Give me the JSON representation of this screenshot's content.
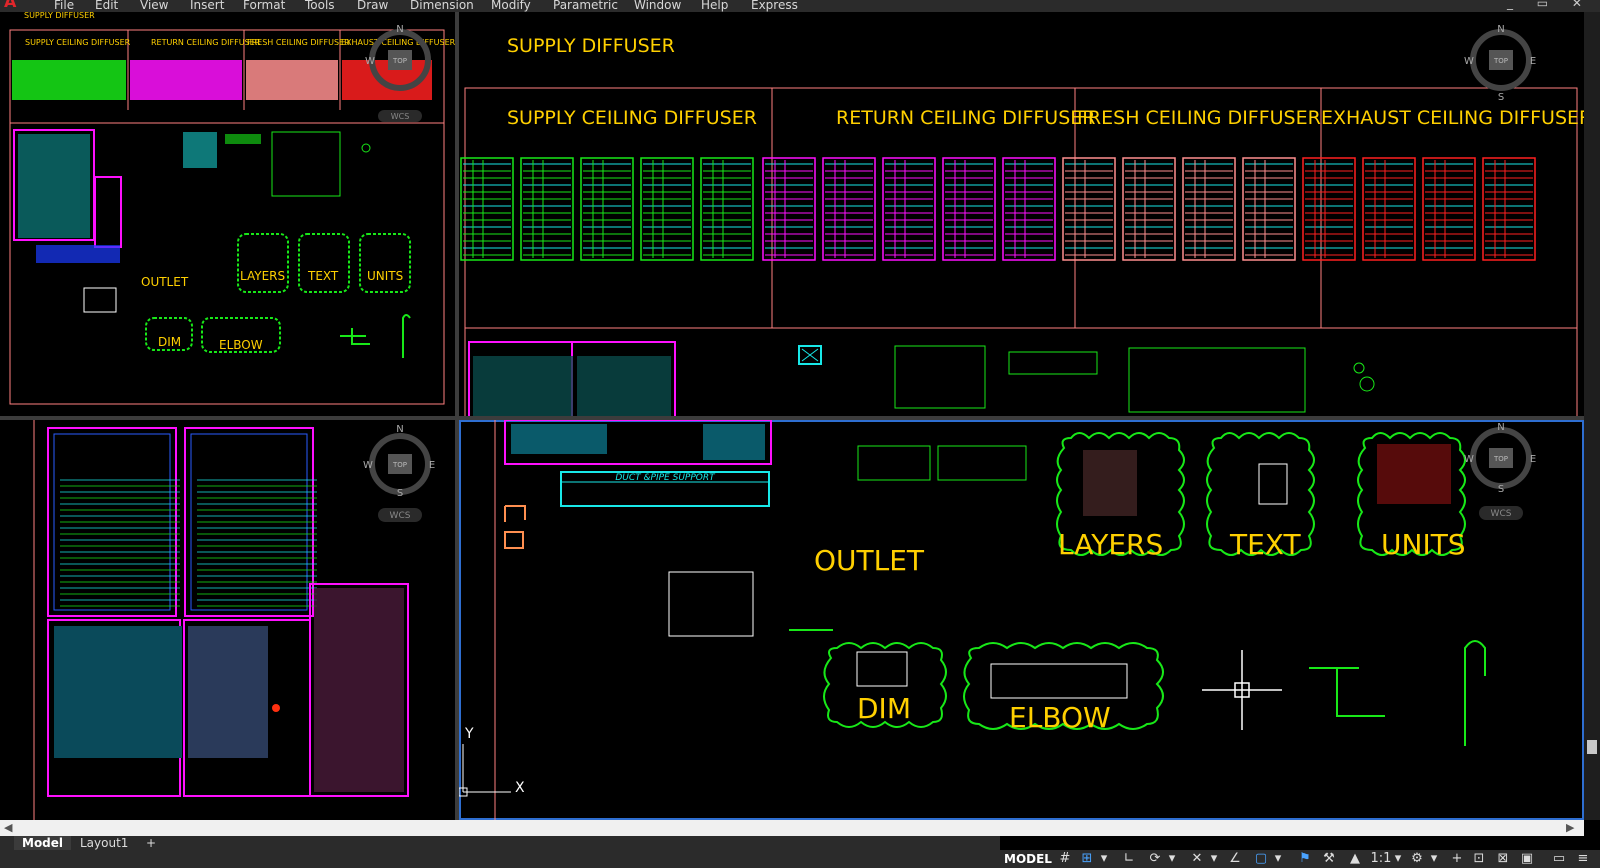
{
  "app": {
    "logo": "A"
  },
  "menu": [
    "File",
    "Edit",
    "View",
    "Insert",
    "Format",
    "Tools",
    "Draw",
    "Dimension",
    "Modify",
    "Parametric",
    "Window",
    "Help",
    "Express"
  ],
  "window_controls": "_ ▭ ✕",
  "viewcube": {
    "north": "N",
    "south": "S",
    "east": "E",
    "west": "W",
    "top": "TOP",
    "wcs": "WCS"
  },
  "vp1": {
    "top_label": "SUPPLY DIFFUSER",
    "headers": [
      "SUPPLY CEILING DIFFUSER",
      "RETURN CEILING DIFFUSER",
      "FRESH CEILING DIFFUSER",
      "EXHAUST CEILING DIFFUSER"
    ],
    "blocks": [
      "OUTLET",
      "LAYERS",
      "TEXT",
      "UNITS",
      "DIM",
      "ELBOW"
    ]
  },
  "vp2": {
    "title": "SUPPLY DIFFUSER",
    "headers": [
      "SUPPLY CEILING DIFFUSER",
      "RETURN CEILING DIFFUSER",
      "FRESH CEILING DIFFUSER",
      "EXHAUST CEILING DIFFUSER"
    ]
  },
  "vp3": {},
  "vp4": {
    "duct_title": "DUCT &PIPE SUPPORT",
    "blocks": [
      "OUTLET",
      "LAYERS",
      "TEXT",
      "UNITS",
      "DIM",
      "ELBOW"
    ],
    "ucs": {
      "x": "X",
      "y": "Y"
    }
  },
  "tabs": [
    "Model",
    "Layout1"
  ],
  "add_tab": "+",
  "status": {
    "model": "MODEL",
    "scale": "1:1"
  },
  "colors": {
    "green": "#18e818",
    "magenta": "#ff10ff",
    "salmon": "#ff8f8f",
    "red": "#ff2020",
    "yellow": "#ffd000",
    "cyan": "#18e8e8",
    "blue": "#2a5cff",
    "border": "#ff8080",
    "active": "#2e6ed1"
  }
}
